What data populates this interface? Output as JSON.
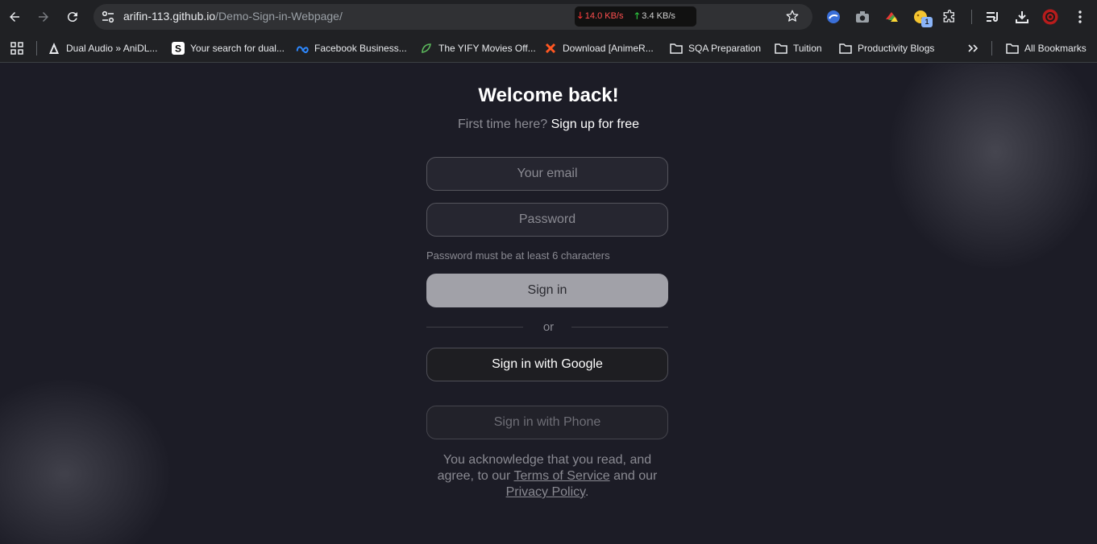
{
  "browser": {
    "url_host": "arifin-113.github.io",
    "url_path": "/Demo-Sign-in-Webpage/",
    "net_down": "14.0 KB/s",
    "net_up": "3.4 KB/s",
    "ext_badge": "1"
  },
  "bookmarks": [
    {
      "label": "Dual Audio » AniDL..."
    },
    {
      "label": "Your search for dual..."
    },
    {
      "label": "Facebook Business..."
    },
    {
      "label": "The YIFY Movies Off..."
    },
    {
      "label": "Download [AnimeR..."
    },
    {
      "label": "SQA Preparation"
    },
    {
      "label": "Tuition"
    },
    {
      "label": "Productivity Blogs"
    },
    {
      "label": "All Bookmarks"
    }
  ],
  "page": {
    "title": "Welcome back!",
    "subtitle_prefix": "First time here?",
    "signup_link": "Sign up for free",
    "email_placeholder": "Your email",
    "password_placeholder": "Password",
    "password_hint": "Password must be at least 6 characters",
    "signin_button": "Sign in",
    "or_text": "or",
    "google_button": "Sign in with Google",
    "phone_button": "Sign in with Phone",
    "legal_1": "You acknowledge that you read, and agree, to our",
    "terms_link": "Terms of Service",
    "legal_2": "and our",
    "privacy_link": "Privacy Policy",
    "legal_end": "."
  },
  "colors": {
    "page_bg": "#1c1c26",
    "signin_bg": "#a1a1a8",
    "chrome_bg": "#202124"
  }
}
